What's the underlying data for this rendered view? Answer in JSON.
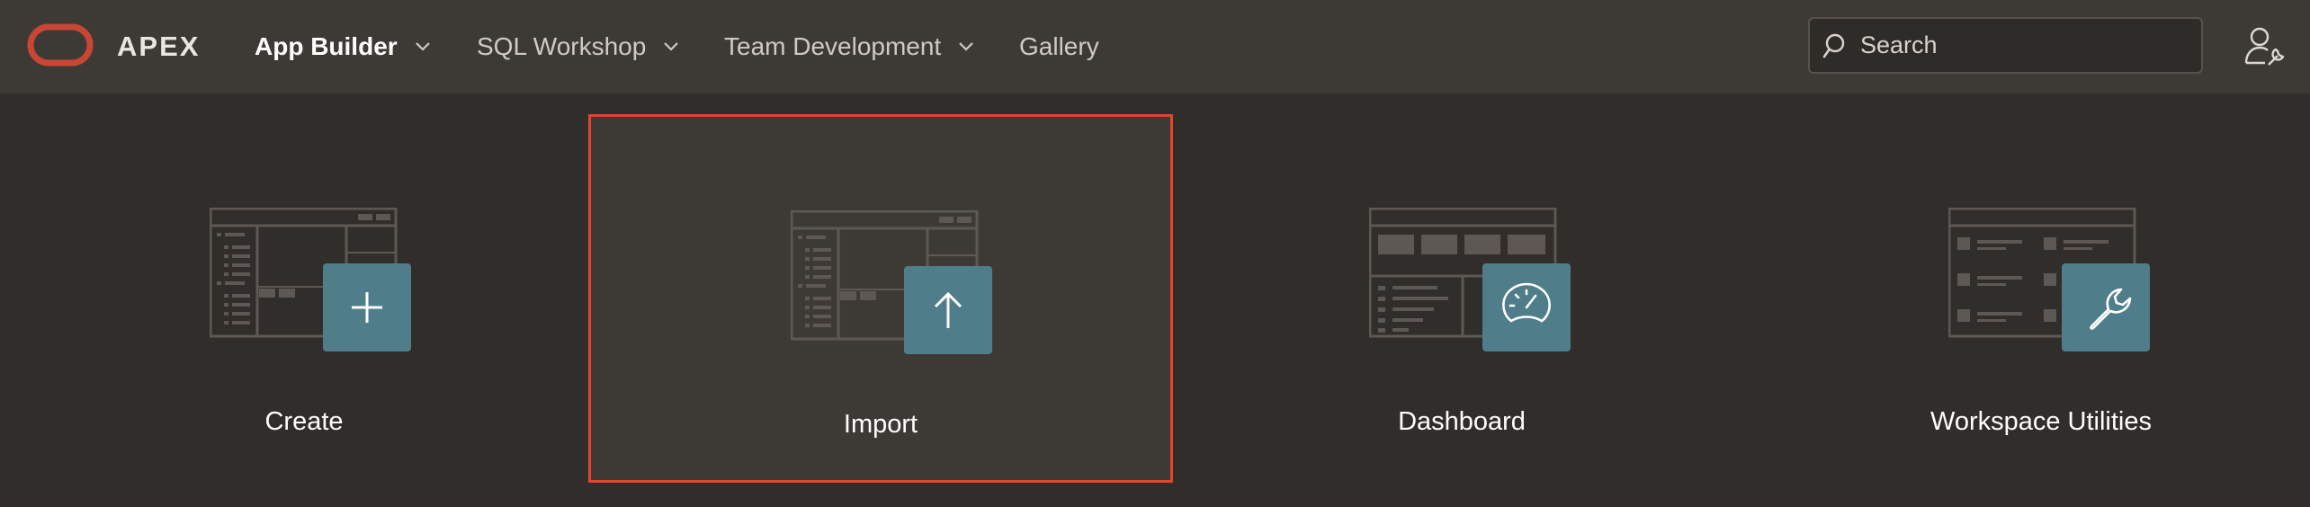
{
  "header": {
    "brand": "APEX",
    "nav": [
      {
        "label": "App Builder",
        "active": true,
        "has_menu": true
      },
      {
        "label": "SQL Workshop",
        "active": false,
        "has_menu": true
      },
      {
        "label": "Team Development",
        "active": false,
        "has_menu": true
      },
      {
        "label": "Gallery",
        "active": false,
        "has_menu": false
      }
    ],
    "search": {
      "placeholder": "Search",
      "value": ""
    }
  },
  "tiles": [
    {
      "label": "Create",
      "icon": "plus-icon",
      "selected": false
    },
    {
      "label": "Import",
      "icon": "upload-arrow-icon",
      "selected": true
    },
    {
      "label": "Dashboard",
      "icon": "speedometer-icon",
      "selected": false
    },
    {
      "label": "Workspace Utilities",
      "icon": "wrench-icon",
      "selected": false
    }
  ],
  "colors": {
    "header_bg": "#3d3a36",
    "page_bg": "#312d2a",
    "brand_red": "#c74634",
    "selection_border": "#e4442e",
    "badge_teal": "#4f7d8a"
  }
}
